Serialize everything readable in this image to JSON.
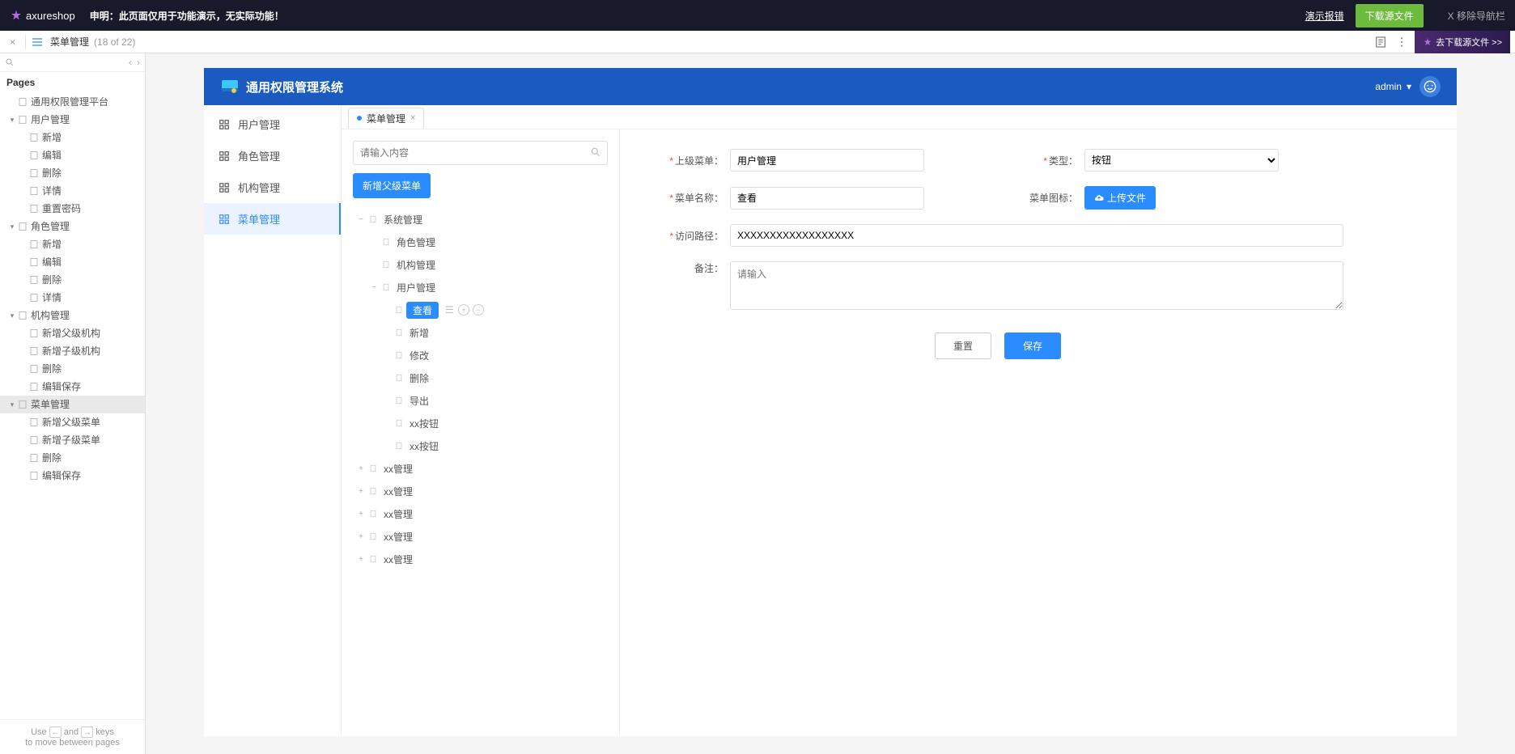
{
  "topbar": {
    "brand": "axureshop",
    "disclaimer": "申明：此页面仅用于功能演示，无实际功能！",
    "report_link": "演示报错",
    "download_btn": "下载源文件",
    "remove_nav": "X 移除导航栏"
  },
  "toolbar": {
    "page_title": "菜单管理",
    "page_count": "(18 of 22)",
    "go_download": "去下载源文件 >>"
  },
  "pages_panel": {
    "header": "Pages",
    "footer_line1_a": "Use",
    "footer_line1_b": "and",
    "footer_line1_c": "keys",
    "footer_line2": "to move between pages",
    "nodes": [
      {
        "lvl": 1,
        "caret": "",
        "label": "通用权限管理平台"
      },
      {
        "lvl": 1,
        "caret": "▾",
        "label": "用户管理"
      },
      {
        "lvl": 2,
        "caret": "",
        "label": "新增"
      },
      {
        "lvl": 2,
        "caret": "",
        "label": "编辑"
      },
      {
        "lvl": 2,
        "caret": "",
        "label": "删除"
      },
      {
        "lvl": 2,
        "caret": "",
        "label": "详情"
      },
      {
        "lvl": 2,
        "caret": "",
        "label": "重置密码"
      },
      {
        "lvl": 1,
        "caret": "▾",
        "label": "角色管理"
      },
      {
        "lvl": 2,
        "caret": "",
        "label": "新增"
      },
      {
        "lvl": 2,
        "caret": "",
        "label": "编辑"
      },
      {
        "lvl": 2,
        "caret": "",
        "label": "删除"
      },
      {
        "lvl": 2,
        "caret": "",
        "label": "详情"
      },
      {
        "lvl": 1,
        "caret": "▾",
        "label": "机构管理"
      },
      {
        "lvl": 2,
        "caret": "",
        "label": "新增父级机构"
      },
      {
        "lvl": 2,
        "caret": "",
        "label": "新增子级机构"
      },
      {
        "lvl": 2,
        "caret": "",
        "label": "删除"
      },
      {
        "lvl": 2,
        "caret": "",
        "label": "编辑保存"
      },
      {
        "lvl": 1,
        "caret": "▾",
        "label": "菜单管理",
        "active": true
      },
      {
        "lvl": 2,
        "caret": "",
        "label": "新增父级菜单"
      },
      {
        "lvl": 2,
        "caret": "",
        "label": "新增子级菜单"
      },
      {
        "lvl": 2,
        "caret": "",
        "label": "删除"
      },
      {
        "lvl": 2,
        "caret": "",
        "label": "编辑保存"
      }
    ]
  },
  "app": {
    "title": "通用权限管理系统",
    "user": "admin"
  },
  "sidenav": {
    "items": [
      {
        "label": "用户管理"
      },
      {
        "label": "角色管理"
      },
      {
        "label": "机构管理"
      },
      {
        "label": "菜单管理",
        "active": true
      }
    ]
  },
  "tabs": {
    "active": "菜单管理"
  },
  "tree": {
    "search_placeholder": "请输入内容",
    "new_parent": "新增父级菜单",
    "nodes": [
      {
        "depth": 1,
        "exp": "−",
        "label": "系统管理"
      },
      {
        "depth": 2,
        "exp": "",
        "label": "角色管理"
      },
      {
        "depth": 2,
        "exp": "",
        "label": "机构管理"
      },
      {
        "depth": 2,
        "exp": "−",
        "label": "用户管理"
      },
      {
        "depth": 3,
        "exp": "",
        "label": "查看",
        "selected": true,
        "actions": true
      },
      {
        "depth": 3,
        "exp": "",
        "label": "新增"
      },
      {
        "depth": 3,
        "exp": "",
        "label": "修改"
      },
      {
        "depth": 3,
        "exp": "",
        "label": "删除"
      },
      {
        "depth": 3,
        "exp": "",
        "label": "导出"
      },
      {
        "depth": 3,
        "exp": "",
        "label": "xx按钮"
      },
      {
        "depth": 3,
        "exp": "",
        "label": "xx按钮"
      },
      {
        "depth": 1,
        "exp": "+",
        "label": "xx管理"
      },
      {
        "depth": 1,
        "exp": "+",
        "label": "xx管理"
      },
      {
        "depth": 1,
        "exp": "+",
        "label": "xx管理"
      },
      {
        "depth": 1,
        "exp": "+",
        "label": "xx管理"
      },
      {
        "depth": 1,
        "exp": "+",
        "label": "xx管理"
      }
    ]
  },
  "form": {
    "parent_menu_label": "上级菜单：",
    "parent_menu_value": "用户管理",
    "type_label": "类型：",
    "type_value": "按钮",
    "name_label": "菜单名称：",
    "name_value": "查看",
    "icon_label": "菜单图标：",
    "upload_label": "上传文件",
    "path_label": "访问路径：",
    "path_value": "XXXXXXXXXXXXXXXXXX",
    "remark_label": "备注：",
    "remark_placeholder": "请输入",
    "reset_btn": "重置",
    "save_btn": "保存"
  }
}
